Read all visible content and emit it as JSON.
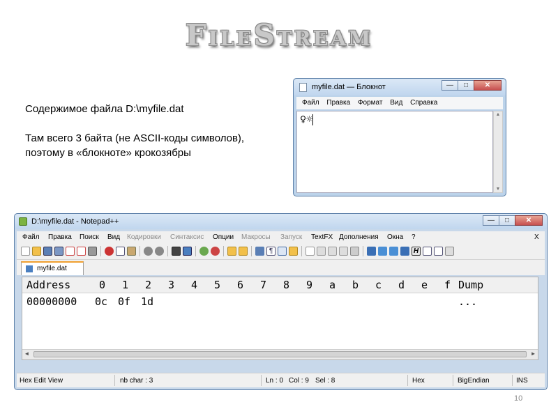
{
  "slide": {
    "title": "FileStream",
    "line1": "Содержимое файла D:\\myfile.dat",
    "line2": "Там всего 3 байта (не ASCII-коды символов),",
    "line3": "поэтому  в «блокноте»  крокозябры",
    "page_number": "10"
  },
  "notepad": {
    "title": "myfile.dat — Блокнот",
    "menu": [
      "Файл",
      "Правка",
      "Формат",
      "Вид",
      "Справка"
    ],
    "content": "♀☼",
    "controls": {
      "minimize": "—",
      "maximize": "□",
      "close": "✕"
    }
  },
  "notepadpp": {
    "title": "D:\\myfile.dat - Notepad++",
    "menu": [
      "Файл",
      "Правка",
      "Поиск",
      "Вид",
      "Кодировки",
      "Синтаксис",
      "Опции",
      "Макросы",
      "Запуск",
      "TextFX",
      "Дополнения",
      "Окна",
      "?"
    ],
    "menu_close": "X",
    "tab_label": "myfile.dat",
    "hex_header": {
      "address": "Address",
      "columns": [
        "0",
        "1",
        "2",
        "3",
        "4",
        "5",
        "6",
        "7",
        "8",
        "9",
        "a",
        "b",
        "c",
        "d",
        "e",
        "f"
      ],
      "dump": "Dump"
    },
    "hex_row": {
      "address": "00000000",
      "bytes": [
        "0c",
        "0f",
        "1d"
      ],
      "dump": "..."
    },
    "status": {
      "mode": "Hex Edit View",
      "nb_char": "nb char : 3",
      "ln": "Ln : 0",
      "col": "Col : 9",
      "sel": "Sel : 8",
      "format": "Hex",
      "endian": "BigEndian",
      "ins": "INS"
    },
    "controls": {
      "minimize": "—",
      "maximize": "□",
      "close": "✕"
    }
  }
}
